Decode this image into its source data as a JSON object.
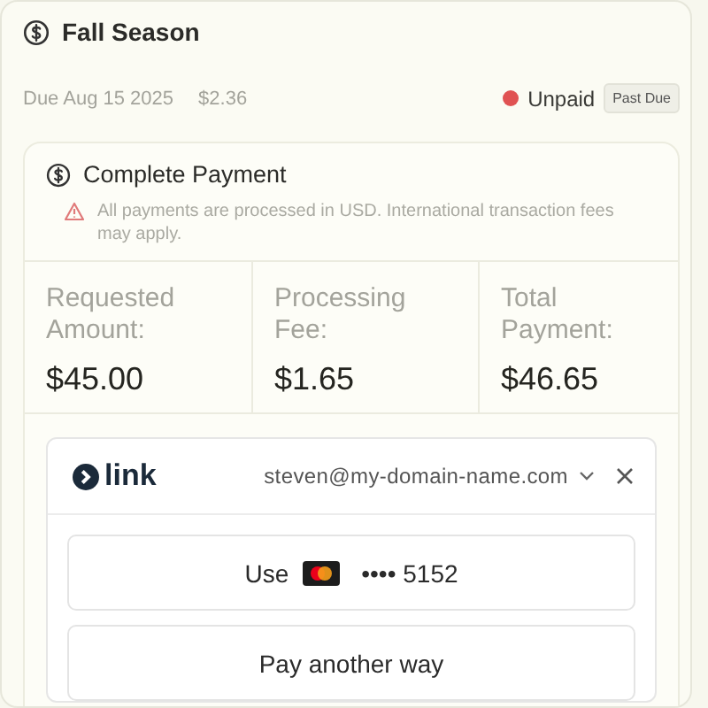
{
  "header": {
    "title": "Fall Season"
  },
  "summary": {
    "due": "Due Aug 15 2025",
    "amount": "$2.36",
    "status": "Unpaid",
    "badge": "Past Due"
  },
  "payment": {
    "title": "Complete Payment",
    "notice": "All payments are processed in USD. International transaction fees may apply.",
    "stats": [
      {
        "label": "Requested Amount:",
        "value": "$45.00"
      },
      {
        "label": "Processing Fee:",
        "value": "$1.65"
      },
      {
        "label": "Total Payment:",
        "value": "$46.65"
      }
    ]
  },
  "link": {
    "logo": "link",
    "email": "steven@my-domain-name.com",
    "buttons": [
      {
        "kind": "saved_card",
        "label": "Use",
        "card": "•••• 5152"
      },
      {
        "kind": "other",
        "label": "Pay another way"
      }
    ]
  }
}
